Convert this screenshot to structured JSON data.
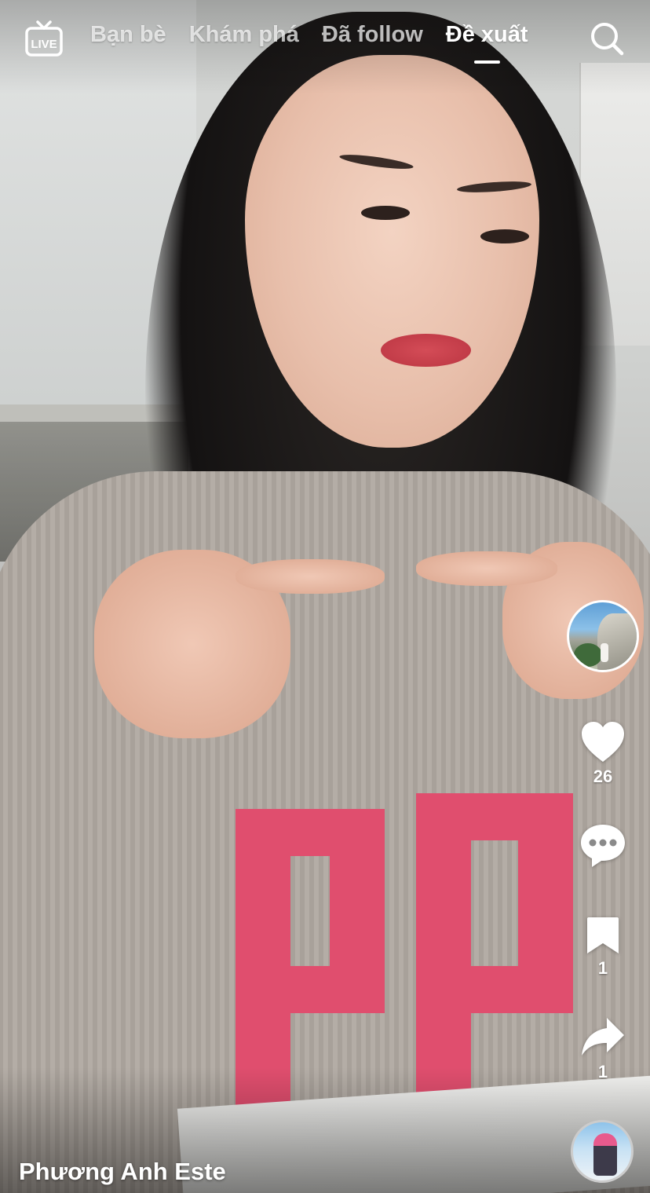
{
  "top_nav": {
    "live_label": "LIVE",
    "tabs": [
      {
        "label": "Bạn bè",
        "active": false
      },
      {
        "label": "Khám phá",
        "active": false
      },
      {
        "label": "Đã follow",
        "active": false
      },
      {
        "label": "Đề xuất",
        "active": true
      }
    ],
    "search_icon": "search-icon"
  },
  "video": {
    "description": "",
    "author": "Phương Anh Este"
  },
  "actions": {
    "like_count": "26",
    "comment_count": "",
    "bookmark_count": "1",
    "share_count": "1"
  },
  "icons": {
    "like": "heart-icon",
    "comment": "comment-icon",
    "bookmark": "bookmark-icon",
    "share": "share-icon"
  },
  "colors": {
    "text": "#ffffff",
    "accent_print": "#e04e6e"
  }
}
